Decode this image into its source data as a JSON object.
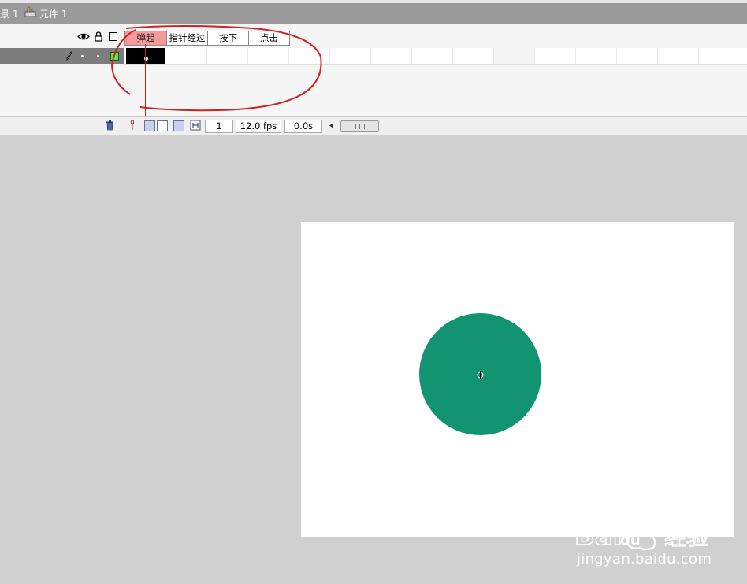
{
  "breadcrumb": {
    "scene": "景 1",
    "symbol": "元件 1"
  },
  "timeline": {
    "frame_labels": [
      "弹起",
      "指针经过",
      "按下",
      "点击"
    ],
    "active_frame_label": 0,
    "current_frame": "1",
    "fps": "12.0 fps",
    "elapsed_time": "0.0s"
  },
  "stage": {
    "shape_color": "#11946f",
    "stage_color": "#ffffff"
  },
  "annotation_color": "#d02020",
  "watermark": {
    "brand": "Bai 经验",
    "url": "jingyan.baidu.com"
  }
}
